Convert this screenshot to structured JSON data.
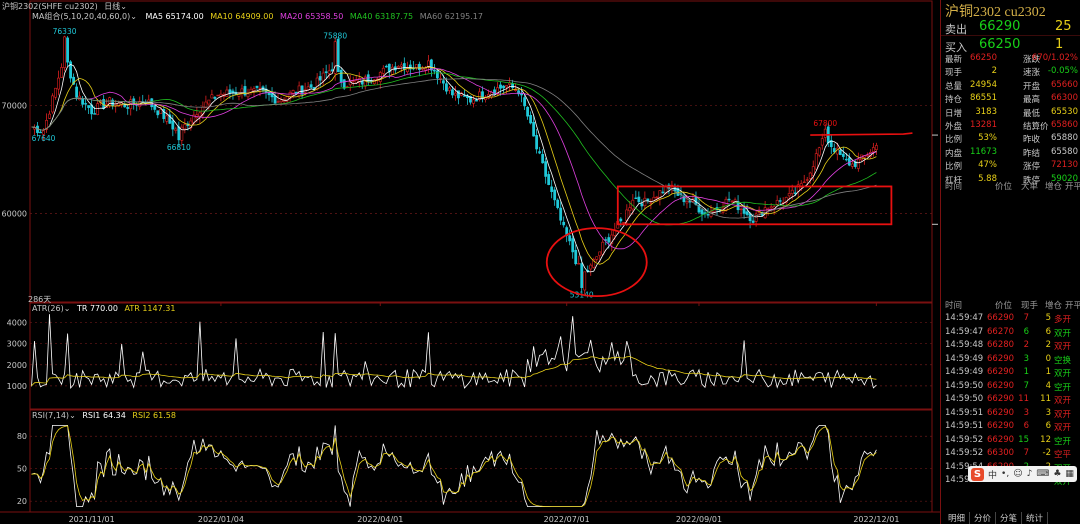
{
  "header": {
    "symbol_label": "沪铜2302(SHFE cu2302)",
    "period": "日线",
    "ma_group": "MA组合(5,10,20,40,60,0)",
    "ma5": "MA5 65174.00",
    "ma10": "MA10 64909.00",
    "ma20": "MA20 65358.50",
    "ma40": "MA40 63187.75",
    "ma60": "MA60 62195.17",
    "days_label": "286天"
  },
  "colors": {
    "up": "#e02020",
    "down": "#20c8d8",
    "ma5": "#ffffff",
    "ma10": "#e8d018",
    "ma20": "#e040e0",
    "ma40": "#20c020",
    "ma60": "#808080",
    "annotation": "#e81010"
  },
  "chart_data": [
    {
      "type": "candlestick",
      "title": "",
      "y_ticks": [
        60000,
        70000
      ],
      "ylim": [
        52000,
        79000
      ],
      "x_ticks": [
        "2021/11/01",
        "2022/01/04",
        "2022/04/01",
        "2022/07/01",
        "2022/09/01",
        "2022/12/01"
      ],
      "annotations": [
        {
          "label": "76330",
          "x_index": 11,
          "value": 76330
        },
        {
          "label": "75880",
          "x_index": 101,
          "value": 75880
        },
        {
          "label": "67640",
          "x_index": 4,
          "value": 67640
        },
        {
          "label": "66810",
          "x_index": 49,
          "value": 66810
        },
        {
          "label": "53140",
          "x_index": 183,
          "value": 53140
        },
        {
          "label": "67800",
          "x_index": 264,
          "value": 67800
        }
      ],
      "highlight_box": {
        "x_index_from": 195,
        "x_index_to": 286,
        "value_from": 59000,
        "value_to": 62500
      },
      "highlight_circle": {
        "x_index": 188,
        "value": 55500
      },
      "resistance_line": {
        "x_index_from": 259,
        "x_index_to": 293,
        "value": 67250
      },
      "close_path": [
        [
          0,
          68000
        ],
        [
          4,
          67640
        ],
        [
          8,
          71500
        ],
        [
          11,
          74800
        ],
        [
          15,
          71000
        ],
        [
          20,
          69500
        ],
        [
          26,
          70300
        ],
        [
          32,
          70000
        ],
        [
          38,
          70500
        ],
        [
          44,
          69000
        ],
        [
          49,
          67400
        ],
        [
          55,
          69500
        ],
        [
          62,
          71000
        ],
        [
          70,
          71300
        ],
        [
          76,
          71200
        ],
        [
          82,
          70500
        ],
        [
          88,
          71300
        ],
        [
          94,
          71800
        ],
        [
          100,
          73500
        ],
        [
          104,
          72000
        ],
        [
          110,
          72200
        ],
        [
          116,
          73000
        ],
        [
          122,
          73800
        ],
        [
          128,
          73500
        ],
        [
          132,
          74000
        ],
        [
          136,
          72500
        ],
        [
          140,
          71000
        ],
        [
          146,
          70500
        ],
        [
          152,
          71300
        ],
        [
          158,
          71800
        ],
        [
          162,
          71400
        ],
        [
          165,
          69000
        ],
        [
          168,
          66000
        ],
        [
          171,
          63500
        ],
        [
          174,
          61000
        ],
        [
          177,
          58500
        ],
        [
          180,
          56500
        ],
        [
          183,
          54200
        ],
        [
          186,
          55000
        ],
        [
          190,
          57000
        ],
        [
          194,
          58500
        ],
        [
          197,
          59500
        ],
        [
          200,
          61500
        ],
        [
          204,
          61000
        ],
        [
          208,
          61800
        ],
        [
          212,
          62500
        ],
        [
          216,
          61500
        ],
        [
          220,
          61000
        ],
        [
          224,
          60000
        ],
        [
          228,
          60500
        ],
        [
          232,
          61300
        ],
        [
          236,
          60500
        ],
        [
          240,
          59500
        ],
        [
          244,
          60500
        ],
        [
          248,
          61000
        ],
        [
          252,
          61500
        ],
        [
          256,
          62500
        ],
        [
          259,
          64000
        ],
        [
          262,
          66000
        ],
        [
          264,
          67000
        ],
        [
          267,
          66000
        ],
        [
          270,
          65000
        ],
        [
          273,
          64500
        ],
        [
          276,
          65000
        ],
        [
          279,
          65800
        ],
        [
          281,
          66300
        ]
      ],
      "last_value": 66290
    },
    {
      "type": "line",
      "title": "ATR(26)",
      "series_labels": [
        "TR 770.00",
        "ATR 1147.31"
      ],
      "y_ticks": [
        1000,
        2000,
        3000,
        4000
      ],
      "ylim": [
        0,
        4500
      ]
    },
    {
      "type": "line",
      "title": "RSI(7,14)",
      "series_labels": [
        "RSI1 64.34",
        "RSI2 61.58"
      ],
      "y_ticks": [
        20,
        50,
        80
      ],
      "ylim": [
        10,
        95
      ]
    }
  ],
  "quote": {
    "title": "沪铜2302  cu2302",
    "sell_label": "卖出",
    "sell_price": "66290",
    "sell_vol": "25",
    "buy_label": "买入",
    "buy_price": "66250",
    "buy_vol": "1",
    "stats": [
      {
        "l1": "最新",
        "v1": "66250",
        "c1": "#e02020",
        "l2": "涨跌",
        "v2": "670/1.02%",
        "c2": "#e02020"
      },
      {
        "l1": "现手",
        "v1": "2",
        "c1": "#e8d018",
        "l2": "速涨",
        "v2": "-0.05%",
        "c2": "#18d018"
      },
      {
        "l1": "总量",
        "v1": "24954",
        "c1": "#e8d018",
        "l2": "开盘",
        "v2": "65660",
        "c2": "#e02020"
      },
      {
        "l1": "持仓",
        "v1": "86551",
        "c1": "#e8d018",
        "l2": "最高",
        "v2": "66300",
        "c2": "#e02020"
      },
      {
        "l1": "日增",
        "v1": "3183",
        "c1": "#e8d018",
        "l2": "最低",
        "v2": "65530",
        "c2": "#e8d018"
      },
      {
        "l1": "外盘",
        "v1": "13281",
        "c1": "#e02020",
        "l2": "结算价",
        "v2": "65860",
        "c2": "#e02020"
      },
      {
        "l1": "比例",
        "v1": "53%",
        "c1": "#e8d018",
        "l2": "昨收",
        "v2": "65880",
        "c2": "#c8c8c8"
      },
      {
        "l1": "内盘",
        "v1": "11673",
        "c1": "#18d018",
        "l2": "昨结",
        "v2": "65580",
        "c2": "#c8c8c8"
      },
      {
        "l1": "比例",
        "v1": "47%",
        "c1": "#e8d018",
        "l2": "涨停",
        "v2": "72130",
        "c2": "#e02020"
      },
      {
        "l1": "杠杆",
        "v1": "5.88",
        "c1": "#e8d018",
        "l2": "跌停",
        "v2": "59020",
        "c2": "#18d018"
      }
    ],
    "section1_headers": [
      "时间",
      "价位",
      "大单",
      "增仓",
      "开平"
    ],
    "section2_headers": [
      "时间",
      "价位",
      "现手",
      "增仓",
      "开平"
    ],
    "trades": [
      {
        "time": "14:59:47",
        "price": "66290",
        "vol": "7",
        "inc": "5",
        "type": "多开",
        "pc": "#e02020",
        "vc": "#e02020",
        "ic": "#e8d018"
      },
      {
        "time": "14:59:47",
        "price": "66270",
        "vol": "6",
        "inc": "6",
        "type": "双开",
        "pc": "#e02020",
        "vc": "#18d018",
        "ic": "#e8d018"
      },
      {
        "time": "14:59:48",
        "price": "66280",
        "vol": "2",
        "inc": "2",
        "type": "双开",
        "pc": "#e02020",
        "vc": "#e02020",
        "ic": "#e8d018"
      },
      {
        "time": "14:59:49",
        "price": "66290",
        "vol": "3",
        "inc": "0",
        "type": "空换",
        "pc": "#e02020",
        "vc": "#18d018",
        "ic": "#e8d018"
      },
      {
        "time": "14:59:49",
        "price": "66290",
        "vol": "1",
        "inc": "1",
        "type": "双开",
        "pc": "#e02020",
        "vc": "#18d018",
        "ic": "#e8d018"
      },
      {
        "time": "14:59:50",
        "price": "66290",
        "vol": "7",
        "inc": "4",
        "type": "空开",
        "pc": "#e02020",
        "vc": "#18d018",
        "ic": "#e8d018"
      },
      {
        "time": "14:59:50",
        "price": "66290",
        "vol": "11",
        "inc": "11",
        "type": "双开",
        "pc": "#e02020",
        "vc": "#e02020",
        "ic": "#e8d018"
      },
      {
        "time": "14:59:51",
        "price": "66290",
        "vol": "3",
        "inc": "3",
        "type": "双开",
        "pc": "#e02020",
        "vc": "#e02020",
        "ic": "#e8d018"
      },
      {
        "time": "14:59:51",
        "price": "66290",
        "vol": "6",
        "inc": "6",
        "type": "双开",
        "pc": "#e02020",
        "vc": "#e02020",
        "ic": "#e8d018"
      },
      {
        "time": "14:59:52",
        "price": "66290",
        "vol": "15",
        "inc": "12",
        "type": "空开",
        "pc": "#e02020",
        "vc": "#18d018",
        "ic": "#e8d018"
      },
      {
        "time": "14:59:52",
        "price": "66300",
        "vol": "7",
        "inc": "-2",
        "type": "空平",
        "pc": "#e02020",
        "vc": "#e02020",
        "ic": "#e8d018"
      },
      {
        "time": "14:59:54",
        "price": "66290",
        "vol": "2",
        "inc": "2",
        "type": "双开",
        "pc": "#e02020",
        "vc": "#18d018",
        "ic": "#e8d018"
      },
      {
        "time": "14:59:59",
        "price": "66250",
        "vol": "2",
        "inc": "2",
        "type": "双开",
        "pc": "#e02020",
        "vc": "#18d018",
        "ic": "#e8d018"
      }
    ],
    "tabs": [
      "明细",
      "分价",
      "分笔",
      "统计"
    ]
  }
}
